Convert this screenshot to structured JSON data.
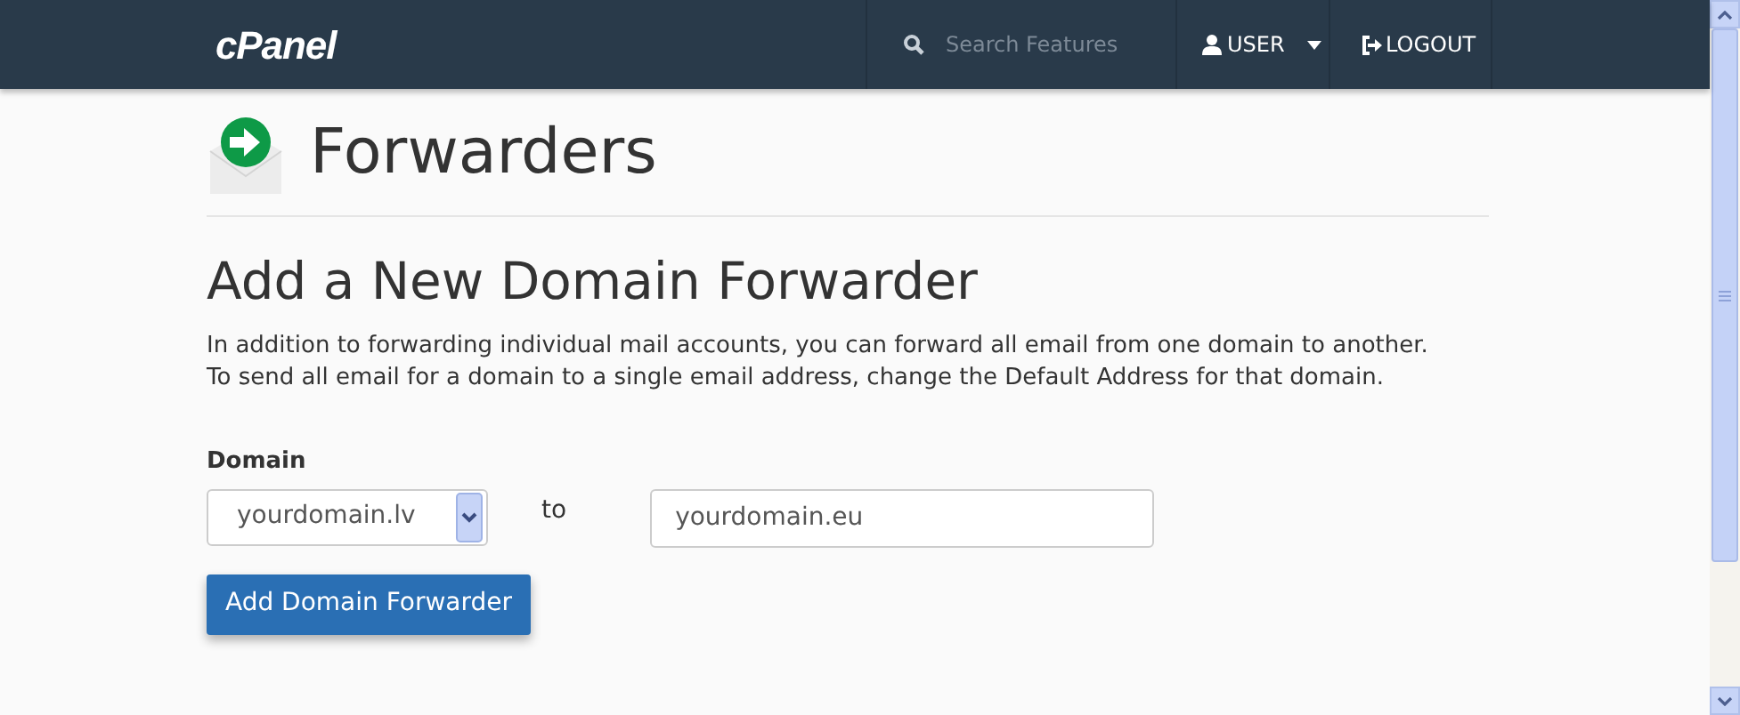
{
  "header": {
    "logo": "cPanel",
    "search": {
      "placeholder": "Search Features"
    },
    "user_menu": "USER",
    "logout": "LOGOUT"
  },
  "page": {
    "title": "Forwarders"
  },
  "section": {
    "title": "Add a New Domain Forwarder",
    "description": [
      "In addition to forwarding individual mail accounts, you can forward all email from one domain to another.",
      "To send all email for a domain to a single email address, change the Default Address for that domain."
    ]
  },
  "form": {
    "domain_label": "Domain",
    "domain_value": "yourdomain.lv",
    "to_label": "to",
    "target_value": "yourdomain.eu",
    "submit": "Add Domain Forwarder"
  }
}
